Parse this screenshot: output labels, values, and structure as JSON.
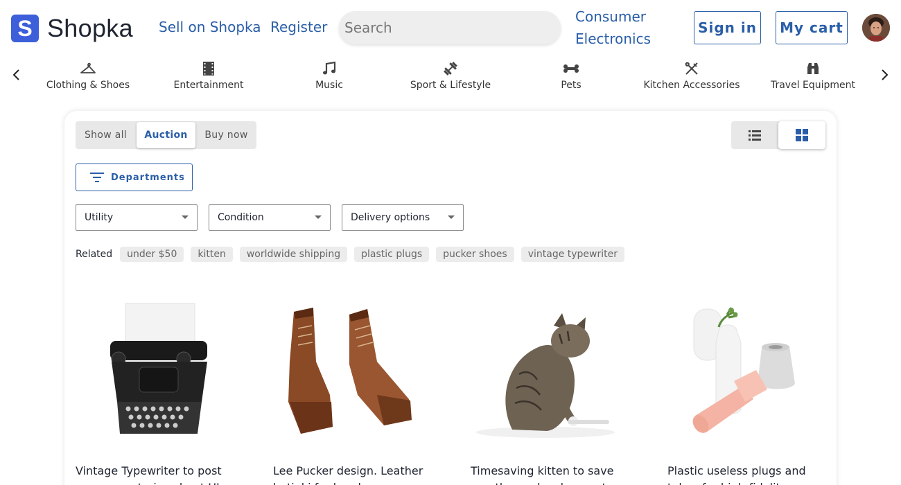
{
  "brand": {
    "logo_letter": "S",
    "name": "Shopka",
    "color": "#3d5fd9"
  },
  "nav": {
    "sell": "Sell on Shopka",
    "register": "Register"
  },
  "search": {
    "placeholder": "Search"
  },
  "category_link": {
    "line1": "Consumer",
    "line2": "Electronics"
  },
  "buttons": {
    "sign_in": "Sign in",
    "my_cart": "My cart"
  },
  "accent_color": "#2a5ea8",
  "categories": [
    {
      "label": "Clothing & Shoes",
      "icon": "hanger-icon"
    },
    {
      "label": "Entertainment",
      "icon": "film-icon"
    },
    {
      "label": "Music",
      "icon": "music-note-icon"
    },
    {
      "label": "Sport & Lifestyle",
      "icon": "dumbbell-icon"
    },
    {
      "label": "Pets",
      "icon": "bone-icon"
    },
    {
      "label": "Kitchen Accessories",
      "icon": "utensils-icon"
    },
    {
      "label": "Travel Equipment",
      "icon": "binoculars-icon"
    }
  ],
  "filters": {
    "segments": [
      "Show all",
      "Auction",
      "Buy now"
    ],
    "active_segment": "Auction",
    "departments": "Departments",
    "selects": [
      "Utility",
      "Condition",
      "Delivery options"
    ],
    "view_active": "grid"
  },
  "related": {
    "label": "Related",
    "tags": [
      "under $50",
      "kitten",
      "worldwide shipping",
      "plastic plugs",
      "pucker shoes",
      "vintage typewriter"
    ]
  },
  "products": [
    {
      "title": "Vintage Typewriter to post awesome stories about UI",
      "image": "typewriter"
    },
    {
      "title": "Lee Pucker design. Leather botinki for handsome",
      "image": "boots"
    },
    {
      "title": "Timesaving kitten to save months on development.",
      "image": "cat"
    },
    {
      "title": "Plastic useless plugs and tubes for high-fidelity",
      "image": "plugs"
    }
  ]
}
